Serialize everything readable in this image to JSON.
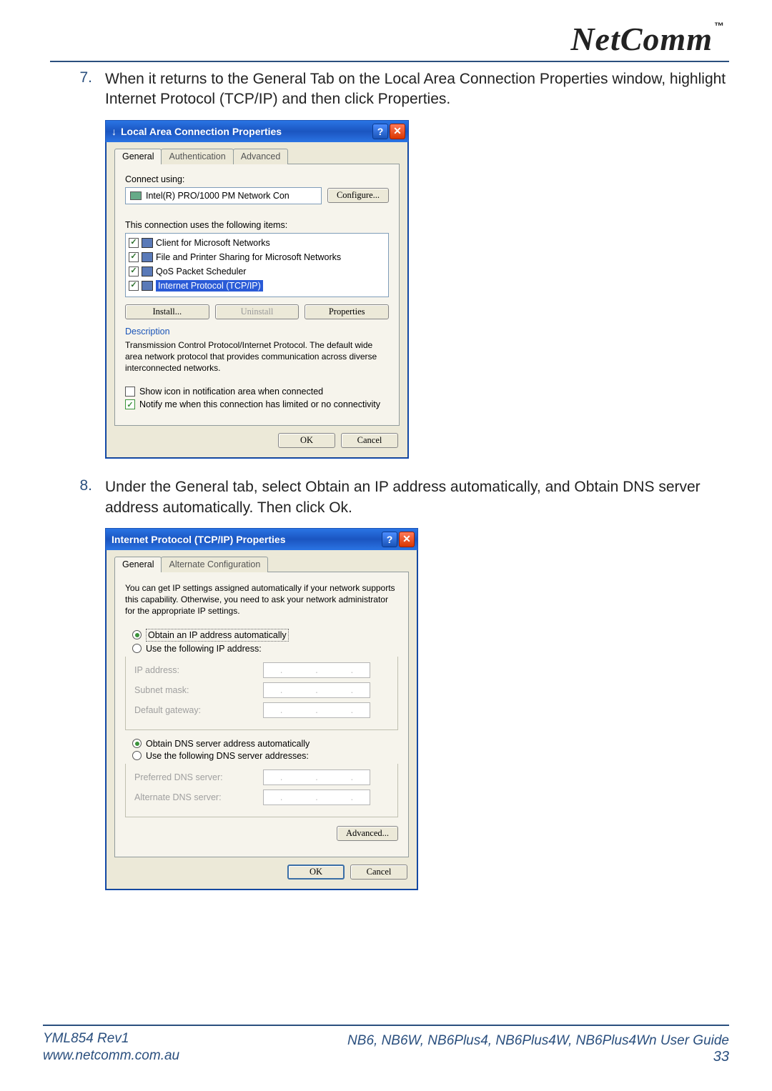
{
  "logo": {
    "brand": "NetComm",
    "tm": "™"
  },
  "steps": [
    {
      "num": "7.",
      "text": "When it returns to the General Tab on the Local Area Connection Properties window, highlight Internet Protocol (TCP/IP) and then click Properties."
    },
    {
      "num": "8.",
      "text": "Under the General tab, select Obtain an IP address automatically, and Obtain DNS server address automatically. Then click Ok."
    }
  ],
  "dialog1": {
    "title": "Local Area Connection Properties",
    "tabs": [
      "General",
      "Authentication",
      "Advanced"
    ],
    "connect_label": "Connect using:",
    "adapter": "Intel(R) PRO/1000 PM Network Con",
    "configure": "Configure...",
    "uses_label": "This connection uses the following items:",
    "items": [
      "Client for Microsoft Networks",
      "File and Printer Sharing for Microsoft Networks",
      "QoS Packet Scheduler",
      "Internet Protocol (TCP/IP)"
    ],
    "install": "Install...",
    "uninstall": "Uninstall",
    "properties": "Properties",
    "desc_label": "Description",
    "desc": "Transmission Control Protocol/Internet Protocol. The default wide area network protocol that provides communication across diverse interconnected networks.",
    "show_icon": "Show icon in notification area when connected",
    "notify": "Notify me when this connection has limited or no connectivity",
    "ok": "OK",
    "cancel": "Cancel"
  },
  "dialog2": {
    "title": "Internet Protocol (TCP/IP) Properties",
    "tabs": [
      "General",
      "Alternate Configuration"
    ],
    "intro": "You can get IP settings assigned automatically if your network supports this capability. Otherwise, you need to ask your network administrator for the appropriate IP settings.",
    "obtain_ip": "Obtain an IP address automatically",
    "use_ip": "Use the following IP address:",
    "ip_address": "IP address:",
    "subnet": "Subnet mask:",
    "gateway": "Default gateway:",
    "obtain_dns": "Obtain DNS server address automatically",
    "use_dns": "Use the following DNS server addresses:",
    "pref_dns": "Preferred DNS server:",
    "alt_dns": "Alternate DNS server:",
    "advanced": "Advanced...",
    "ok": "OK",
    "cancel": "Cancel"
  },
  "footer": {
    "rev": "YML854 Rev1",
    "url": "www.netcomm.com.au",
    "guide": "NB6, NB6W, NB6Plus4, NB6Plus4W, NB6Plus4Wn User Guide",
    "page": "33"
  }
}
